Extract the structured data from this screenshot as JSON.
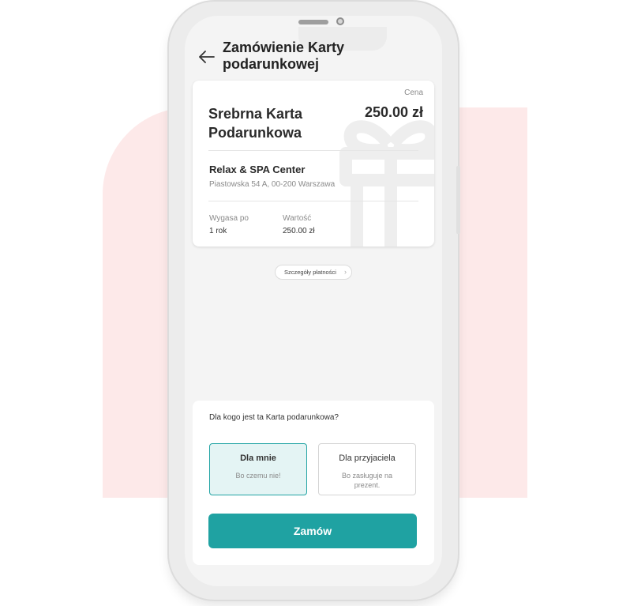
{
  "header": {
    "title": "Zamówienie Karty podarunkowej",
    "back_icon": "arrow-left-icon"
  },
  "card": {
    "price_label": "Cena",
    "name": "Srebrna Karta Podarunkowa",
    "price": "250.00 zł",
    "venue": "Relax & SPA Center",
    "address": "Piastowska 54 A, 00-200 Warszawa",
    "expires_label": "Wygasa po",
    "expires_value": "1 rok",
    "value_label": "Wartość",
    "value_value": "250.00 zł",
    "decoration_icon": "gift-icon"
  },
  "details_link": {
    "label": "Szczegóły płatności",
    "icon": "chevron-right-icon"
  },
  "recipient": {
    "question": "Dla kogo jest ta Karta podarunkowa?",
    "options": [
      {
        "title": "Dla mnie",
        "subtitle": "Bo czemu nie!",
        "selected": true
      },
      {
        "title": "Dla przyjaciela",
        "subtitle": "Bo zasługuje na prezent.",
        "selected": false
      }
    ]
  },
  "order_button": {
    "label": "Zamów"
  },
  "colors": {
    "accent": "#1fa2a2",
    "selected_bg": "#e4f4f4",
    "background_shape": "#fde9e9"
  }
}
